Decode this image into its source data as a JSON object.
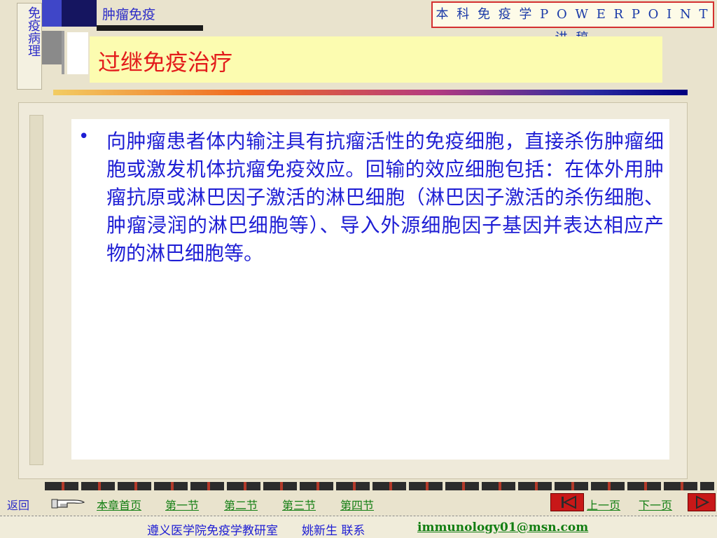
{
  "sidebar": {
    "vertical_label": "免疫病理"
  },
  "header": {
    "section_name": "肿瘤免疫",
    "banner_text": "本 科 免 疫 学 P O W E R P O I N T 讲 稿"
  },
  "slide": {
    "title": "过继免疫治疗",
    "bullet": "向肿瘤患者体内输注具有抗瘤活性的免疫细胞，直接杀伤肿瘤细胞或激发机体抗瘤免疫效应。回输的效应细胞包括：在体外用肿瘤抗原或淋巴因子激活的淋巴细胞（淋巴因子激活的杀伤细胞、肿瘤浸润的淋巴细胞等）、导入外源细胞因子基因并表达相应产物的淋巴细胞等。"
  },
  "nav": {
    "back": "返回",
    "chapter_home": "本章首页",
    "sec1": "第一节",
    "sec2": "第二节",
    "sec3": "第三节",
    "sec4": "第四节",
    "prev_page": "上一页",
    "next_page": "下一页"
  },
  "footer": {
    "text": "遵义医学院免疫学教研室　　姚新生  联系",
    "email": "immunology01@msn.com"
  },
  "colors": {
    "accent_blue": "#1e1ed4",
    "title_red": "#e31b1b",
    "link_green": "#127e12"
  }
}
